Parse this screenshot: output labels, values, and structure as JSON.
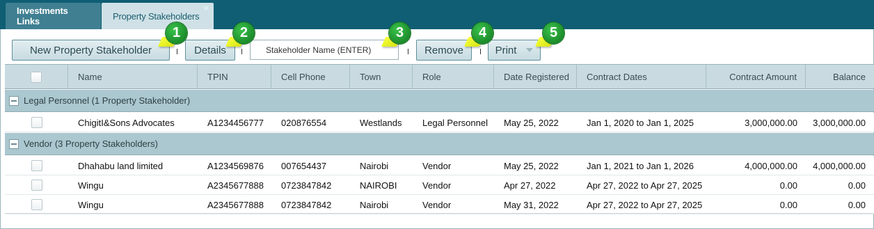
{
  "tabs": [
    {
      "label": "Investments Links"
    },
    {
      "label": "Property Stakeholders",
      "close": "×"
    }
  ],
  "toolbar": {
    "new_label": "New Property Stakeholder",
    "details_label": "Details",
    "search_placeholder": "Stakeholder Name (ENTER)",
    "remove_label": "Remove",
    "print_label": "Print"
  },
  "callouts": [
    "1",
    "2",
    "3",
    "4",
    "5"
  ],
  "columns": [
    "Name",
    "TPIN",
    "Cell Phone",
    "Town",
    "Role",
    "Date Registered",
    "Contract Dates",
    "Contract Amount",
    "Balance"
  ],
  "groups": [
    {
      "title": "Legal Personnel (1 Property Stakeholder)",
      "rows": [
        {
          "name": "ChigitI&Sons Advocates",
          "tpin": "A1234456777",
          "phone": "020876554",
          "town": "Westlands",
          "role": "Legal Personnel",
          "date": "May 25, 2022",
          "contract": "Jan 1, 2020 to Jan 1, 2025",
          "amount": "3,000,000.00",
          "balance": "3,000,000.00"
        }
      ]
    },
    {
      "title": "Vendor (3 Property Stakeholders)",
      "rows": [
        {
          "name": "Dhahabu land limited",
          "tpin": "A1234569876",
          "phone": "007654437",
          "town": "Nairobi",
          "role": "Vendor",
          "date": "May 25, 2022",
          "contract": "Jan 1, 2021 to Jan 1, 2026",
          "amount": "4,000,000.00",
          "balance": "4,000,000.00"
        },
        {
          "name": "Wingu",
          "tpin": "A2345677888",
          "phone": "0723847842",
          "town": "NAIROBI",
          "role": "Vendor",
          "date": "Apr 27, 2022",
          "contract": "Apr 27, 2022 to Apr 27, 2025",
          "amount": "0.00",
          "balance": "0.00"
        },
        {
          "name": "Wingu",
          "tpin": "A2345677888",
          "phone": "0723847842",
          "town": "Nairobi",
          "role": "Vendor",
          "date": "May 31, 2022",
          "contract": "Apr 27, 2022 to Apr 27, 2025",
          "amount": "0.00",
          "balance": "0.00"
        }
      ]
    }
  ],
  "colors": {
    "tabbar": "#0f5e73",
    "header": "#c9dbe0",
    "group": "#abc7cf",
    "callout": "#1c8b2b",
    "arrow": "#f6ff3c"
  }
}
